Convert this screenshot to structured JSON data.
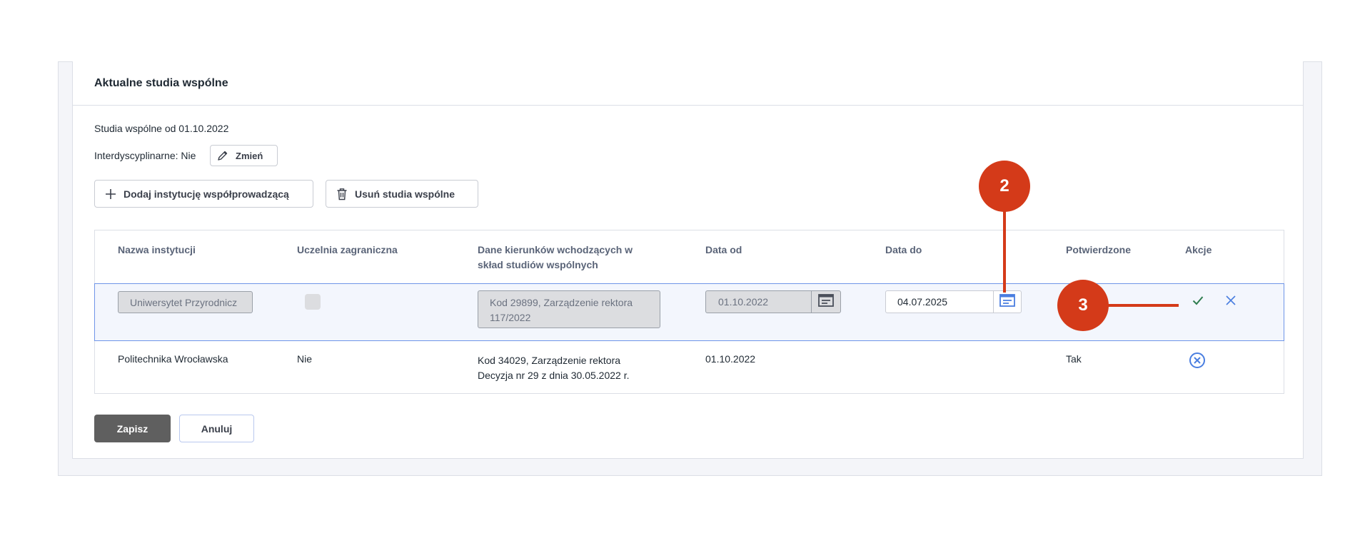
{
  "section": {
    "title": "Aktualne studia wspólne",
    "since_text": "Studia wspólne od 01.10.2022",
    "interdisciplinary_text": "Interdyscyplinarne: Nie",
    "change_label": "Zmień"
  },
  "actions": {
    "add_institution_label": "Dodaj instytucję współprowadzącą",
    "remove_label": "Usuń studia wspólne"
  },
  "table": {
    "headers": {
      "institution": "Nazwa instytucji",
      "foreign": "Uczelnia zagraniczna",
      "programs_line1": "Dane kierunków wchodzących w",
      "programs_line2": "skład studiów wspólnych",
      "date_from": "Data od",
      "date_to": "Data do",
      "confirmed": "Potwierdzone",
      "actions": "Akcje"
    },
    "edit_row": {
      "institution": "Uniwersytet Przyrodnicz",
      "programs_line1": "Kod 29899,  Zarządzenie rektora",
      "programs_line2": "117/2022",
      "date_from": "01.10.2022",
      "date_to": "04.07.2025"
    },
    "row": {
      "institution": "Politechnika Wrocławska",
      "foreign": "Nie",
      "programs_line1": "Kod 34029, Zarządzenie rektora",
      "programs_line2": "Decyzja nr 29 z dnia 30.05.2022 r.",
      "date_from": "01.10.2022",
      "confirmed": "Tak"
    }
  },
  "annotations": {
    "badge2": "2",
    "badge3": "3"
  },
  "footer": {
    "save_label": "Zapisz",
    "cancel_label": "Anuluj"
  },
  "colors": {
    "accent": "#4a7ee0",
    "badge": "#d43a19",
    "confirm": "#2e7d4f"
  },
  "icons": [
    "pencil-icon",
    "plus-icon",
    "trash-icon",
    "calendar-icon",
    "check-icon",
    "close-icon",
    "circle-x-icon"
  ]
}
